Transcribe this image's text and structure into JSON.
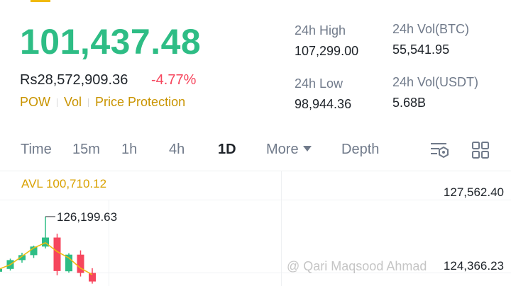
{
  "ticker": {
    "last_price": "101,437.48",
    "fiat_price": "Rs28,572,909.36",
    "change_pct": "-4.77%",
    "tags": [
      "POW",
      "Vol",
      "Price Protection"
    ]
  },
  "stats": {
    "high_label": "24h High",
    "high_value": "107,299.00",
    "low_label": "24h Low",
    "low_value": "98,944.36",
    "vol_btc_label": "24h Vol(BTC)",
    "vol_btc_value": "55,541.95",
    "vol_usdt_label": "24h Vol(USDT)",
    "vol_usdt_value": "5.68B"
  },
  "timeframes": {
    "items": [
      "Time",
      "15m",
      "1h",
      "4h",
      "1D",
      "More",
      "Depth"
    ],
    "active": "1D"
  },
  "toolbar_icons": [
    "indicator-settings-icon",
    "grid-layout-icon"
  ],
  "chart": {
    "avl_label": "AVL 100,710.12",
    "axis_top": "127,562.40",
    "axis_bottom": "124,366.23",
    "high_marker": "126,199.63"
  },
  "watermark": "@ Qari Maqsood Ahmad",
  "colors": {
    "up": "#2ebd85",
    "down": "#f6465d",
    "accent": "#f0b90b",
    "ma_line": "#f0b90b"
  },
  "chart_data": {
    "type": "candlestick",
    "title": "",
    "candles": [
      {
        "open": 103.0,
        "high": 104.5,
        "low": 101.0,
        "close": 104.2
      },
      {
        "open": 104.2,
        "high": 108.5,
        "low": 103.5,
        "close": 107.9
      },
      {
        "open": 107.9,
        "high": 111.0,
        "low": 106.8,
        "close": 110.0
      },
      {
        "open": 110.0,
        "high": 114.0,
        "low": 108.8,
        "close": 113.6
      },
      {
        "open": 113.6,
        "high": 126.2,
        "low": 112.8,
        "close": 117.4
      },
      {
        "open": 117.4,
        "high": 119.0,
        "low": 101.5,
        "close": 103.3
      },
      {
        "open": 103.2,
        "high": 110.8,
        "low": 102.6,
        "close": 110.2
      },
      {
        "open": 110.2,
        "high": 112.0,
        "low": 101.0,
        "close": 102.5
      },
      {
        "open": 102.5,
        "high": 104.5,
        "low": 98.0,
        "close": 98.9
      }
    ],
    "ma": [
      104.0,
      106.0,
      109.5,
      113.0,
      115.2,
      111.5,
      108.8,
      104.5,
      101.8
    ]
  }
}
